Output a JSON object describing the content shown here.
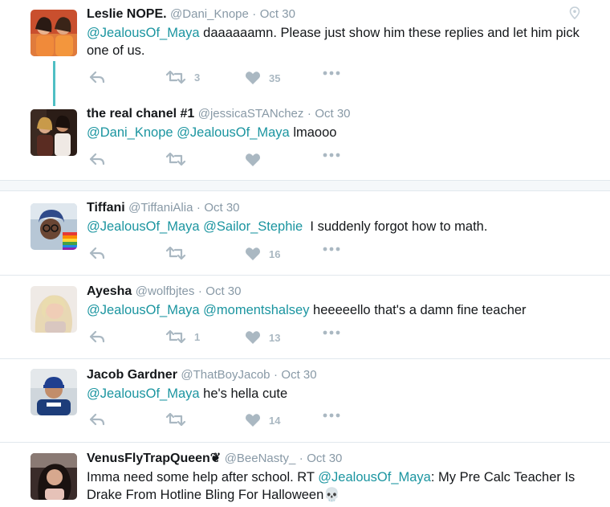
{
  "tweets": [
    {
      "name": "Leslie NOPE.",
      "handle": "@Dani_Knope",
      "dot": "·",
      "time": "Oct 30",
      "text_parts": [
        "@JealousOf_Maya",
        " daaaaaamn. Please just show him these replies and let him pick one of us."
      ],
      "retweets": "3",
      "likes": "35"
    },
    {
      "name": "the real chanel #1",
      "handle": "@jessicaSTANchez",
      "dot": "·",
      "time": "Oct 30",
      "text_parts": [
        "@Dani_Knope @JealousOf_Maya",
        " lmaooo"
      ],
      "retweets": "",
      "likes": ""
    },
    {
      "name": "Tiffani",
      "handle": "@TiffaniAlia",
      "dot": "·",
      "time": "Oct 30",
      "text_parts": [
        "@JealousOf_Maya @Sailor_Stephie",
        "  I suddenly forgot how to math."
      ],
      "retweets": "",
      "likes": "16"
    },
    {
      "name": "Ayesha",
      "handle": "@wolfbjtes",
      "dot": "·",
      "time": "Oct 30",
      "text_parts": [
        "@JealousOf_Maya @momentshalsey",
        " heeeeello that's a damn fine teacher"
      ],
      "retweets": "1",
      "likes": "13"
    },
    {
      "name": "Jacob Gardner",
      "handle": "@ThatBoyJacob",
      "dot": "·",
      "time": "Oct 30",
      "text_parts": [
        "@JealousOf_Maya",
        " he's hella cute"
      ],
      "retweets": "",
      "likes": "14"
    },
    {
      "name": "VenusFlyTrapQueen❦",
      "handle": "@BeeNasty_",
      "dot": "·",
      "time": "Oct 30",
      "text_parts": [
        "Imma need some help after school. RT ",
        "@JealousOf_Maya",
        ": My Pre Calc Teacher Is Drake From Hotline Bling For Halloween",
        "💀"
      ]
    }
  ],
  "colors": {
    "mention": "#1b95a0",
    "thread_line": "#4fbfc4",
    "action_icon": "#aab8c2",
    "muted_text": "#8899a6"
  },
  "icons": [
    "reply-icon",
    "retweet-icon",
    "like-icon",
    "more-icon",
    "location-pin-icon",
    "skull-icon"
  ]
}
